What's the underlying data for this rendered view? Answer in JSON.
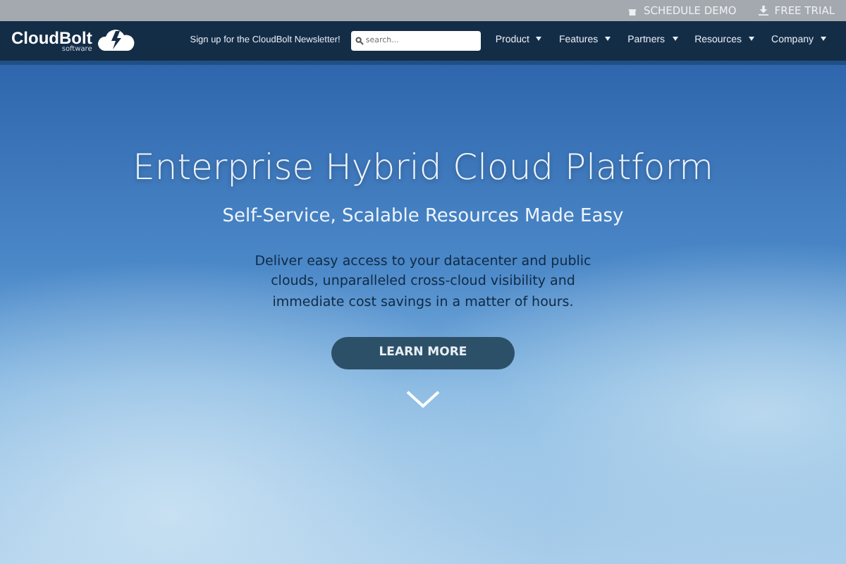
{
  "top_bar": {
    "links": [
      {
        "kind": "demo",
        "label": "SCHEDULE DEMO"
      },
      {
        "kind": "trial",
        "label": "FREE TRIAL"
      }
    ]
  },
  "navbar": {
    "logo": {
      "name": "CloudBolt",
      "tagline": "software"
    },
    "newsletter": "Sign up for the CloudBolt Newsletter!",
    "search": {
      "placeholder": "search..."
    },
    "menu": [
      {
        "label": "Product",
        "dropdown": true
      },
      {
        "label": "Features",
        "dropdown": true
      },
      {
        "label": "Partners",
        "dropdown": true
      },
      {
        "label": "Resources",
        "dropdown": true
      },
      {
        "label": "Company",
        "dropdown": true
      }
    ]
  },
  "hero": {
    "title": "Enterprise Hybrid Cloud Platform",
    "subtitle": "Self-Service, Scalable Resources Made Easy",
    "description": "Deliver easy access to your datacenter and public clouds, unparalleled cross-cloud visibility and immediate cost savings in a matter of hours.",
    "button": "LEARN MORE"
  }
}
